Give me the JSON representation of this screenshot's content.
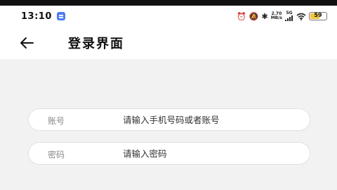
{
  "status_bar": {
    "time": "13:10",
    "network_speed_value": "2.70",
    "network_speed_unit": "MB/s",
    "signal_label": "5G",
    "battery_level": "59",
    "battery_fraction": 0.59
  },
  "header": {
    "title": "登录界面"
  },
  "form": {
    "account": {
      "label": "账号",
      "placeholder": "请输入手机号码或者账号"
    },
    "password": {
      "label": "密码",
      "placeholder": "请输入密码"
    }
  }
}
